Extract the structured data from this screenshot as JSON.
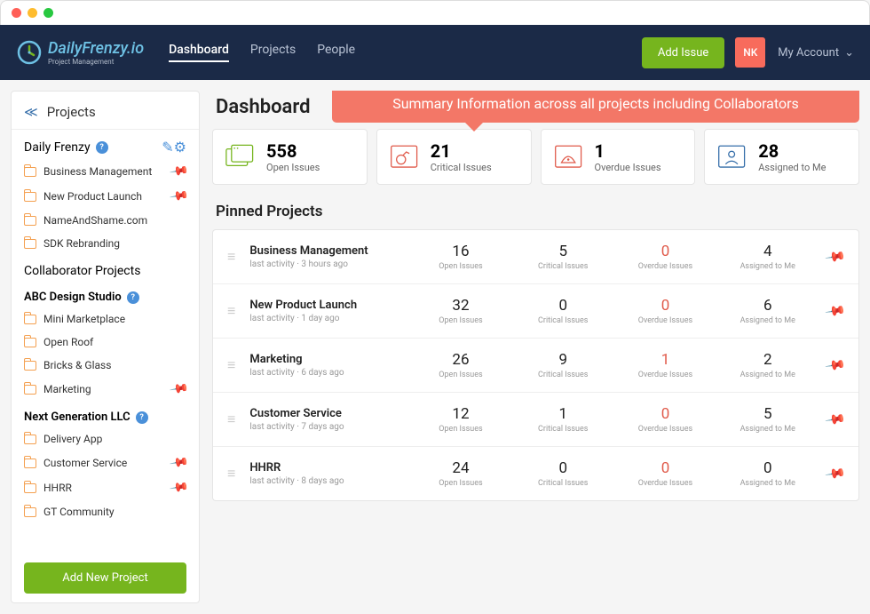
{
  "brand": {
    "name": "DailyFrenzy.io",
    "tagline": "Project Management"
  },
  "nav": {
    "items": [
      "Dashboard",
      "Projects",
      "People"
    ],
    "active": 0
  },
  "header": {
    "add_issue": "Add Issue",
    "avatar": "NK",
    "account": "My Account"
  },
  "sidebar": {
    "title": "Projects",
    "org": "Daily Frenzy",
    "my_projects": [
      {
        "name": "Business Management",
        "pinned": true
      },
      {
        "name": "New Product Launch",
        "pinned": true
      },
      {
        "name": "NameAndShame.com",
        "pinned": false
      },
      {
        "name": "SDK Rebranding",
        "pinned": false
      }
    ],
    "collab_title": "Collaborator Projects",
    "collab_groups": [
      {
        "name": "ABC Design Studio",
        "projects": [
          {
            "name": "Mini Marketplace",
            "pinned": false
          },
          {
            "name": "Open Roof",
            "pinned": false
          },
          {
            "name": "Bricks & Glass",
            "pinned": false
          },
          {
            "name": "Marketing",
            "pinned": true
          }
        ]
      },
      {
        "name": "Next Generation LLC",
        "projects": [
          {
            "name": "Delivery App",
            "pinned": false
          },
          {
            "name": "Customer Service",
            "pinned": true
          },
          {
            "name": "HHRR",
            "pinned": true
          },
          {
            "name": "GT Community",
            "pinned": false
          }
        ]
      }
    ],
    "add_btn": "Add New Project"
  },
  "main": {
    "title": "Dashboard",
    "tooltip": "Summary Information across all projects including Collaborators",
    "stats": [
      {
        "value": "558",
        "label": "Open Issues"
      },
      {
        "value": "21",
        "label": "Critical Issues"
      },
      {
        "value": "1",
        "label": "Overdue Issues"
      },
      {
        "value": "28",
        "label": "Assigned to Me"
      }
    ],
    "pinned_title": "Pinned Projects",
    "metric_labels": [
      "Open Issues",
      "Critical Issues",
      "Overdue Issues",
      "Assigned to Me"
    ],
    "pinned": [
      {
        "name": "Business Management",
        "activity": "last activity · 3 hours ago",
        "vals": [
          "16",
          "5",
          "0",
          "4"
        ]
      },
      {
        "name": "New Product Launch",
        "activity": "last activity · 1 day ago",
        "vals": [
          "32",
          "0",
          "0",
          "6"
        ]
      },
      {
        "name": "Marketing",
        "activity": "last activity · 6 days ago",
        "vals": [
          "26",
          "9",
          "1",
          "2"
        ]
      },
      {
        "name": "Customer Service",
        "activity": "last activity · 7 days ago",
        "vals": [
          "12",
          "1",
          "0",
          "5"
        ]
      },
      {
        "name": "HHRR",
        "activity": "last activity · 8 days ago",
        "vals": [
          "24",
          "0",
          "0",
          "0"
        ]
      }
    ]
  }
}
